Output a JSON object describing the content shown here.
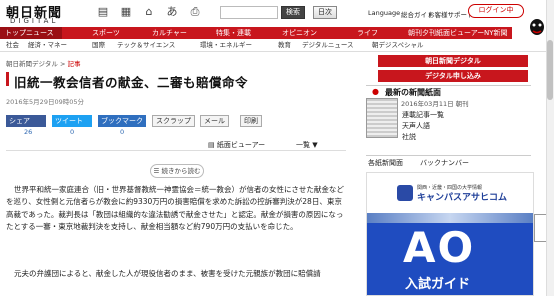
{
  "header": {
    "logo_main": "朝日新聞",
    "logo_sub": "DIGITAL",
    "icons": [
      "bookmark-icon",
      "grid-icon",
      "home-icon",
      "text-size-icon",
      "print-icon"
    ],
    "search_placeholder": "",
    "search_button": "検索",
    "jp_button": "日次",
    "links": [
      "Language",
      "総合ガイド",
      "お客様サポート"
    ],
    "login_button": "ログイン中"
  },
  "nav": {
    "items": [
      "トップニュース",
      "スポーツ",
      "カルチャー",
      "特集・連載",
      "オピニオン",
      "ライフ",
      "朝刊夕刊紙面ビューアー",
      "NY新聞"
    ]
  },
  "subnav": {
    "items": [
      "社会",
      "経済・マネー",
      "国際",
      "テック＆サイエンス",
      "環境・エネルギー",
      "教育",
      "デジタルニュース",
      "朝デジスペシャル"
    ]
  },
  "breadcrumb": {
    "root": "朝日新聞デジタル",
    "separator": " > ",
    "current": "記事"
  },
  "article": {
    "title": "旧統一教会信者の献金、二審も賠償命令",
    "date": "2016年5月29日09時05分",
    "share": {
      "buttons": [
        "シェア",
        "ツイート",
        "ブックマーク",
        "スクラップ",
        "メール",
        "印刷"
      ],
      "counts": [
        "26",
        "0",
        "0"
      ]
    },
    "print_label": "紙面ビューアー",
    "pager_label": "一覧 ▼",
    "photo_button": "続きから読む",
    "paragraph1": "世界平和統一家庭連合（旧・世界基督教統一神霊協会＝統一教会）が信者の女性にさせた献金などを巡り、女性側と元信者らが教会に約9330万円の損害賠償を求めた訴訟の控訴審判決が28日、東京高裁であった。裁判長は「教団は組織的な違法勧誘で献金させた」と認定。献金が損害の原因になったとする一審・東京地裁判決を支持し、献金相当額など約790万円の支払いを命じた。",
    "paragraph2": "元夫の弁護団によると、献金した人が現役信者のまま、被害を受けた元親族が教団に賠償請"
  },
  "sidebar": {
    "button1": "朝日新聞デジタル",
    "button2": "デジタル申し込み",
    "newspaper_heading": "最新の新聞紙面",
    "newspaper_date": "2016年03月11日 朝刊",
    "links": [
      "連載記事一覧",
      "天声人語",
      "社説"
    ],
    "news_tabs": [
      "各紙新聞面",
      "バックナンバー"
    ]
  },
  "ad": {
    "subtitle": "関西・近畿・四国の大学情報",
    "logo": "キャンパスアサヒコム",
    "big_text": "AO",
    "guide_text": "入試ガイド"
  },
  "colors": {
    "brand_red": "#c8161d",
    "ad_blue": "#1f4cc0"
  }
}
